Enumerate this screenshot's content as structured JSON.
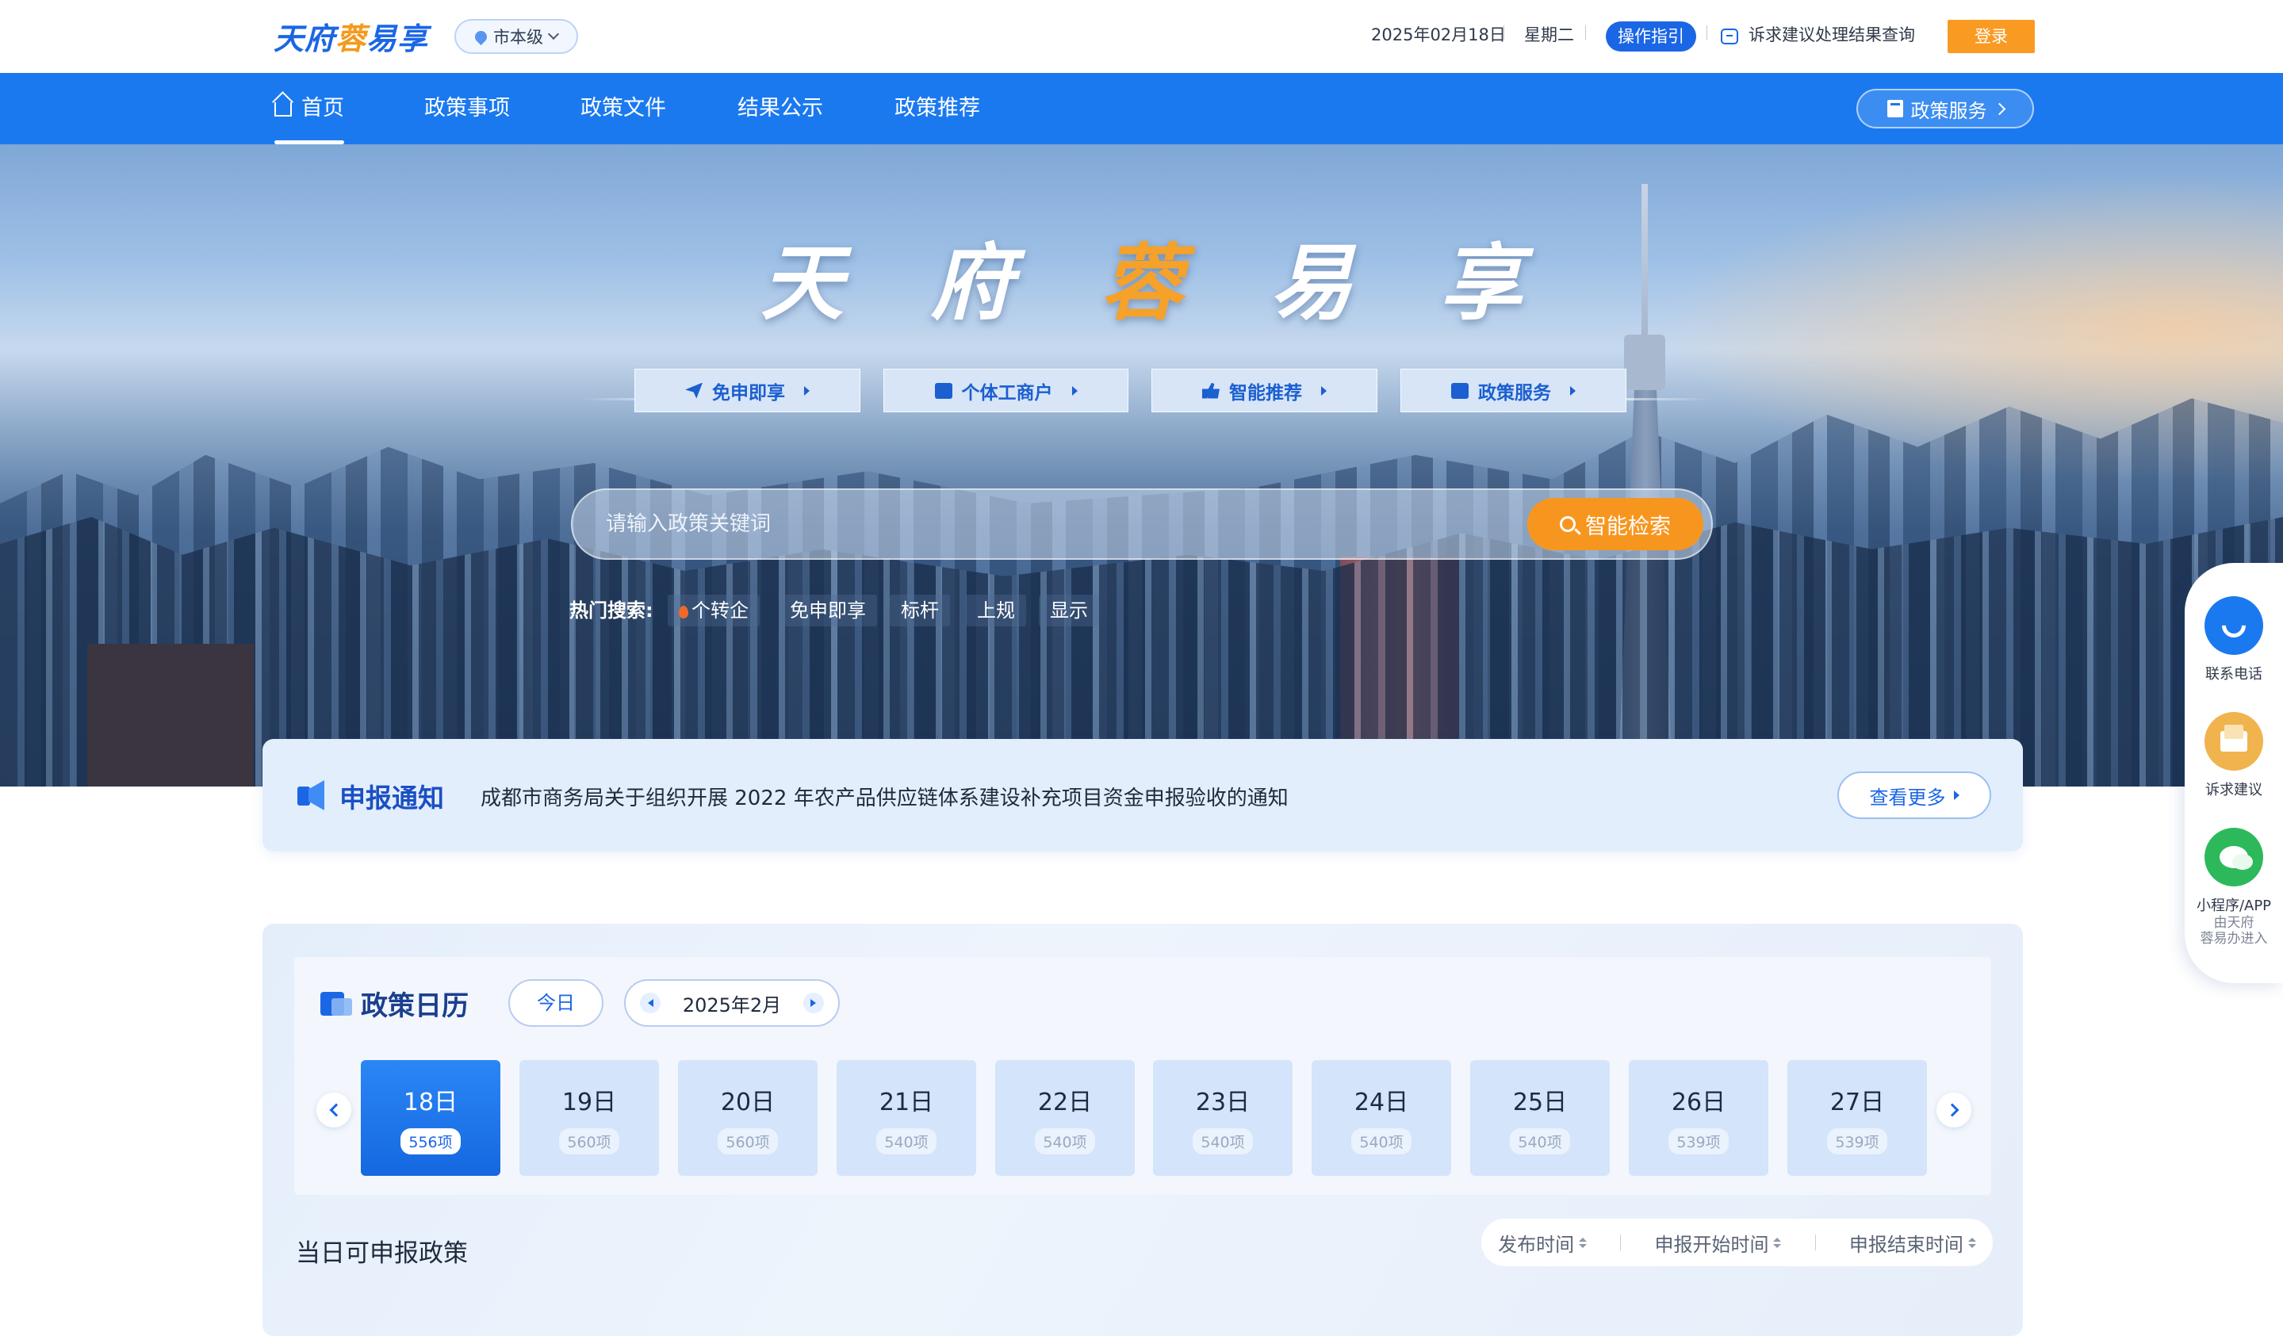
{
  "topbar": {
    "logo": {
      "pre": "天府",
      "highlight": "蓉",
      "post": "易享"
    },
    "level_label": "市本级",
    "date": "2025年02月18日",
    "weekday": "星期二",
    "guide_label": "操作指引",
    "complaint_label": "诉求建议处理结果查询",
    "login_label": "登录"
  },
  "nav": {
    "items": [
      "首页",
      "政策事项",
      "政策文件",
      "结果公示",
      "政策推荐"
    ],
    "active_index": 0,
    "policy_service_label": "政策服务"
  },
  "hero": {
    "title_chars": [
      "天",
      "府",
      "蓉",
      "易",
      "享"
    ],
    "highlight_char": "蓉",
    "quick_links": [
      "免申即享",
      "个体工商户",
      "智能推荐",
      "政策服务"
    ],
    "search": {
      "placeholder": "请输入政策关键词",
      "button_label": "智能检索"
    },
    "hot_search": {
      "label": "热门搜索:",
      "items": [
        "个转企",
        "免申即享",
        "标杆",
        "上规",
        "显示"
      ]
    }
  },
  "notice": {
    "title": "申报通知",
    "text": "成都市商务局关于组织开展 2022 年农产品供应链体系建设补充项目资金申报验收的通知",
    "more_label": "查看更多"
  },
  "calendar": {
    "title": "政策日历",
    "today_label": "今日",
    "month_label": "2025年2月",
    "days": [
      {
        "day": "18日",
        "count": "556项",
        "active": true
      },
      {
        "day": "19日",
        "count": "560项"
      },
      {
        "day": "20日",
        "count": "560项"
      },
      {
        "day": "21日",
        "count": "540项"
      },
      {
        "day": "22日",
        "count": "540项"
      },
      {
        "day": "23日",
        "count": "540项"
      },
      {
        "day": "24日",
        "count": "540项"
      },
      {
        "day": "25日",
        "count": "540项"
      },
      {
        "day": "26日",
        "count": "539项"
      },
      {
        "day": "27日",
        "count": "539项"
      }
    ],
    "policy_heading": "当日可申报政策",
    "sort_options": [
      "发布时间",
      "申报开始时间",
      "申报结束时间"
    ]
  },
  "float_panel": {
    "phone_label": "联系电话",
    "suggest_label": "诉求建议",
    "app_label": "小程序/APP",
    "app_sub_line1": "由天府",
    "app_sub_line2": "蓉易办进入"
  },
  "colors": {
    "brand_blue": "#1b79f0",
    "accent_orange": "#f7961f",
    "login_orange": "#f99b23"
  }
}
